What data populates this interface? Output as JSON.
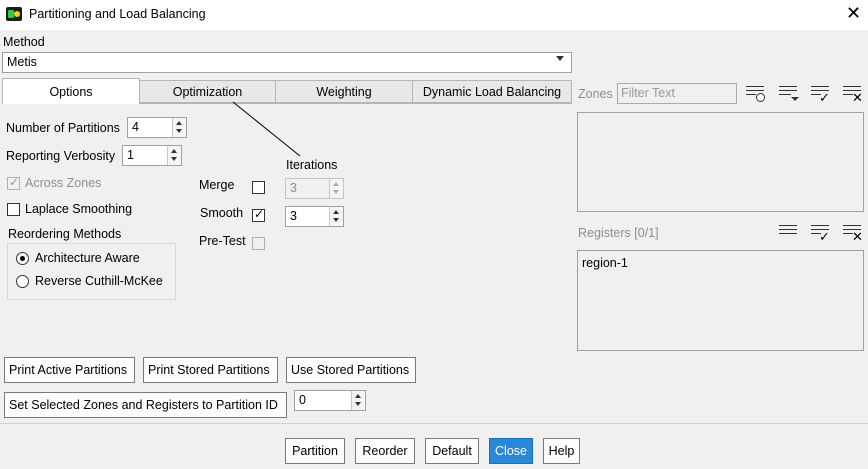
{
  "window": {
    "title": "Partitioning and Load Balancing"
  },
  "method": {
    "label": "Method",
    "value": "Metis"
  },
  "tabs": [
    "Options",
    "Optimization",
    "Weighting",
    "Dynamic Load Balancing"
  ],
  "options": {
    "num_partitions_label": "Number of Partitions",
    "num_partitions_value": "4",
    "verbosity_label": "Reporting Verbosity",
    "verbosity_value": "1",
    "across_zones_label": "Across Zones",
    "laplace_label": "Laplace Smoothing",
    "reordering_label": "Reordering Methods",
    "reorder_opt1": "Architecture Aware",
    "reorder_opt2": "Reverse Cuthill-McKee",
    "iterations_label": "Iterations",
    "merge_label": "Merge",
    "merge_iter": "3",
    "smooth_label": "Smooth",
    "smooth_iter": "3",
    "pretest_label": "Pre-Test"
  },
  "zones": {
    "label": "Zones",
    "filter_placeholder": "Filter Text"
  },
  "registers": {
    "label": "Registers",
    "count": "[0/1]",
    "items": [
      "region-1"
    ]
  },
  "actions": {
    "print_active": "Print Active Partitions",
    "print_stored": "Print Stored Partitions",
    "use_stored": "Use Stored Partitions",
    "set_selected": "Set Selected Zones and Registers to Partition ID",
    "partition_id": "0"
  },
  "footer": {
    "partition": "Partition",
    "reorder": "Reorder",
    "default": "Default",
    "close": "Close",
    "help": "Help"
  },
  "colors": {
    "accent": "#2b88d8",
    "background": "#f0f0f0"
  }
}
